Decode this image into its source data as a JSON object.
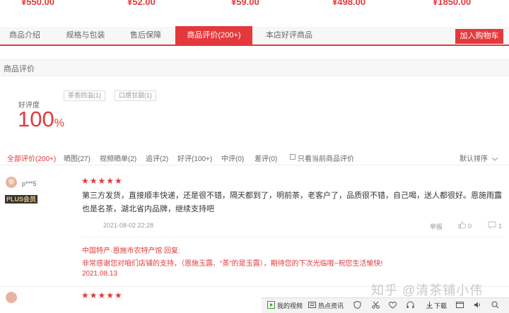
{
  "prices": [
    "¥550.00",
    "¥52.00",
    "¥59.00",
    "¥498.00",
    "¥1850.00"
  ],
  "tabs": [
    {
      "label": "商品介绍"
    },
    {
      "label": "规格与包装"
    },
    {
      "label": "售后保障"
    },
    {
      "label": "商品评价(200+)"
    },
    {
      "label": "本店好评商品"
    }
  ],
  "cart_button": "加入购物车",
  "section_title": "商品评价",
  "rating": {
    "label": "好评度",
    "value": "100",
    "unit": "%"
  },
  "tags": [
    "茶香四溢(1)",
    "口感甘甜(1)"
  ],
  "filters": [
    "全部评价(200+)",
    "晒图(27)",
    "视频晒单(2)",
    "追评(2)",
    "好评(100+)",
    "中评(0)",
    "差评(0)"
  ],
  "only_current_label": "只看当前商品评价",
  "sort_label": "默认排序",
  "review": {
    "username": "p***5",
    "badge": "PLUS会员",
    "stars": "★★★★★",
    "content": "第三方发货，直接顺丰快递，还是很不错，隔天都到了，明前茶，老客户了，品质很不错，自己喝，送人都很好。恩施雨露也是名茶，湖北省内品牌，继续支持吧",
    "date": "2021-08-02 22:28",
    "report": "举报",
    "likes": "0",
    "comments": "1",
    "reply_head": "中国特产·恩施市农特产馆 回复:",
    "reply_text": "非常感谢您对咱们店铺的支持，（恩施玉露、“蒸”的是玉露），期待您的下次光临哦~祝您生活愉快!",
    "reply_date": "2021.08.13"
  },
  "next_review_stars": "★★★★★",
  "watermark": "知乎 @清茶铺小伟",
  "taskbar": [
    "我的视频",
    "热点资讯",
    "下载"
  ]
}
